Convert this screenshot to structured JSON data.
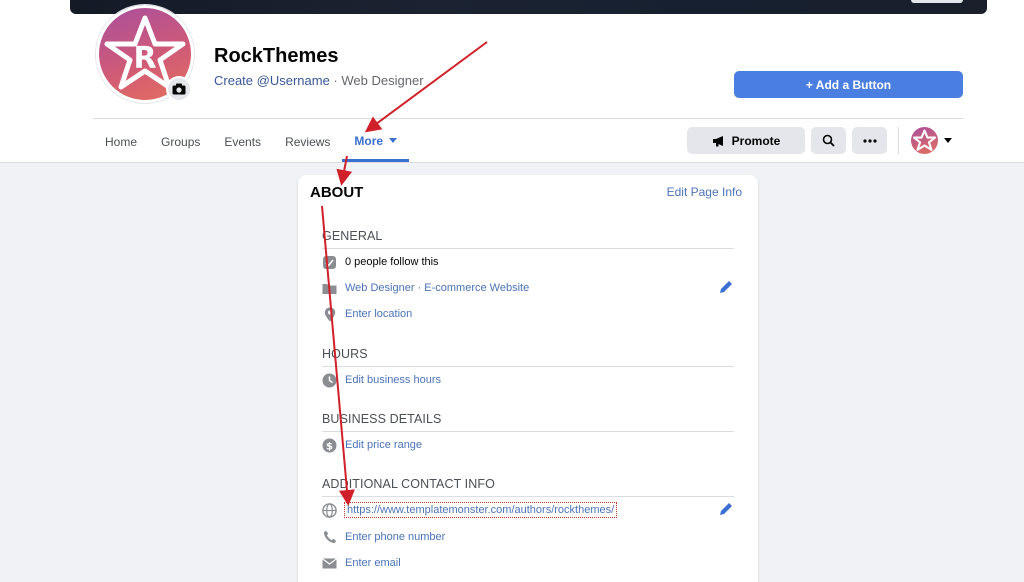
{
  "page": {
    "name": "RockThemes",
    "username_link": "Create @Username",
    "separator": "·",
    "category": "Web Designer"
  },
  "actions": {
    "add_button": "+ Add a Button",
    "promote": "Promote"
  },
  "tabs": [
    {
      "label": "Home"
    },
    {
      "label": "Groups"
    },
    {
      "label": "Events"
    },
    {
      "label": "Reviews"
    },
    {
      "label": "More",
      "active": true
    }
  ],
  "about": {
    "title": "ABOUT",
    "edit_link": "Edit Page Info",
    "general": {
      "title": "GENERAL",
      "followers": "0 people follow this",
      "categories": "Web Designer · E-commerce Website",
      "location": "Enter location"
    },
    "hours": {
      "title": "HOURS",
      "edit": "Edit business hours"
    },
    "business": {
      "title": "BUSINESS DETAILS",
      "price": "Edit price range"
    },
    "contact": {
      "title": "ADDITIONAL CONTACT INFO",
      "website": "https://www.templatemonster.com/authors/rockthemes/",
      "phone": "Enter phone number",
      "email": "Enter email"
    }
  },
  "colors": {
    "accent": "#3b6fd0",
    "primary_button": "#4a7ee0",
    "annotation_arrow": "#d0202a",
    "background": "#f0f2f5"
  },
  "icons": [
    "camera-icon",
    "megaphone-icon",
    "search-icon",
    "more-icon",
    "followers-icon",
    "folder-icon",
    "location-pin-icon",
    "clock-icon",
    "dollar-icon",
    "globe-icon",
    "phone-icon",
    "mail-icon",
    "pencil-icon"
  ]
}
